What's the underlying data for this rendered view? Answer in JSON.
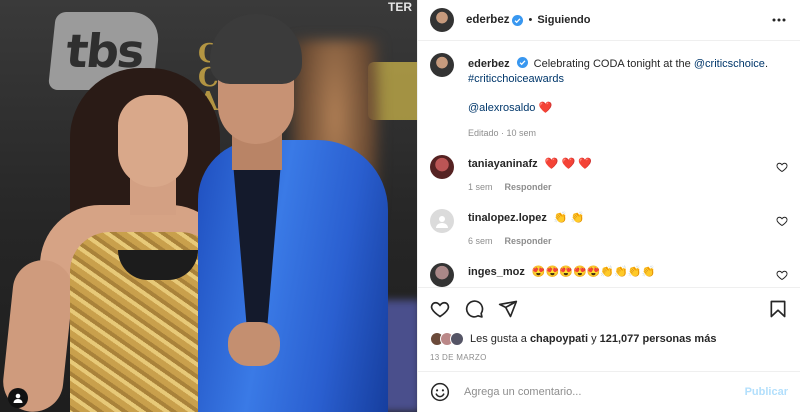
{
  "photo": {
    "bg_logo": "tbs",
    "bg_critics": "C\nC\nA",
    "bg_top_right": "TER"
  },
  "header": {
    "username": "ederbez",
    "separator": "•",
    "follow_state": "Siguiendo"
  },
  "caption": {
    "username": "ederbez",
    "text": "Celebrating CODA tonight at the",
    "mention": "@criticschoice",
    "period": ".",
    "hashtag": "#criticchoiceawards",
    "tagged": "@alexrosaldo",
    "tagged_emoji": "❤️",
    "edited": "Editado · 10 sem"
  },
  "comments": [
    {
      "username": "taniayaninafz",
      "text": "❤️ ❤️ ❤️",
      "time": "1 sem",
      "reply": "Responder"
    },
    {
      "username": "tinalopez.lopez",
      "text": "👏 👏",
      "time": "6 sem",
      "reply": "Responder"
    },
    {
      "username": "inges_moz",
      "text": "😍😍😍😍😍👏👏👏👏",
      "time": "",
      "reply": ""
    }
  ],
  "likes": {
    "prefix": "Les gusta a",
    "user": "chapoypati",
    "mid": "y",
    "count": "121,077",
    "suffix": "personas más"
  },
  "date": "13 DE MARZO",
  "compose": {
    "placeholder": "Agrega un comentario...",
    "publish": "Publicar"
  },
  "colors": {
    "verified": "#3897f0",
    "heart": "#ed4956",
    "link": "#00376b",
    "muted": "#8e8e8e",
    "publish": "#b2dffc"
  },
  "icons": [
    "more-options-icon",
    "verified-icon",
    "heart-icon",
    "comment-icon",
    "share-icon",
    "save-icon",
    "emoji-icon",
    "user-tag-icon"
  ]
}
